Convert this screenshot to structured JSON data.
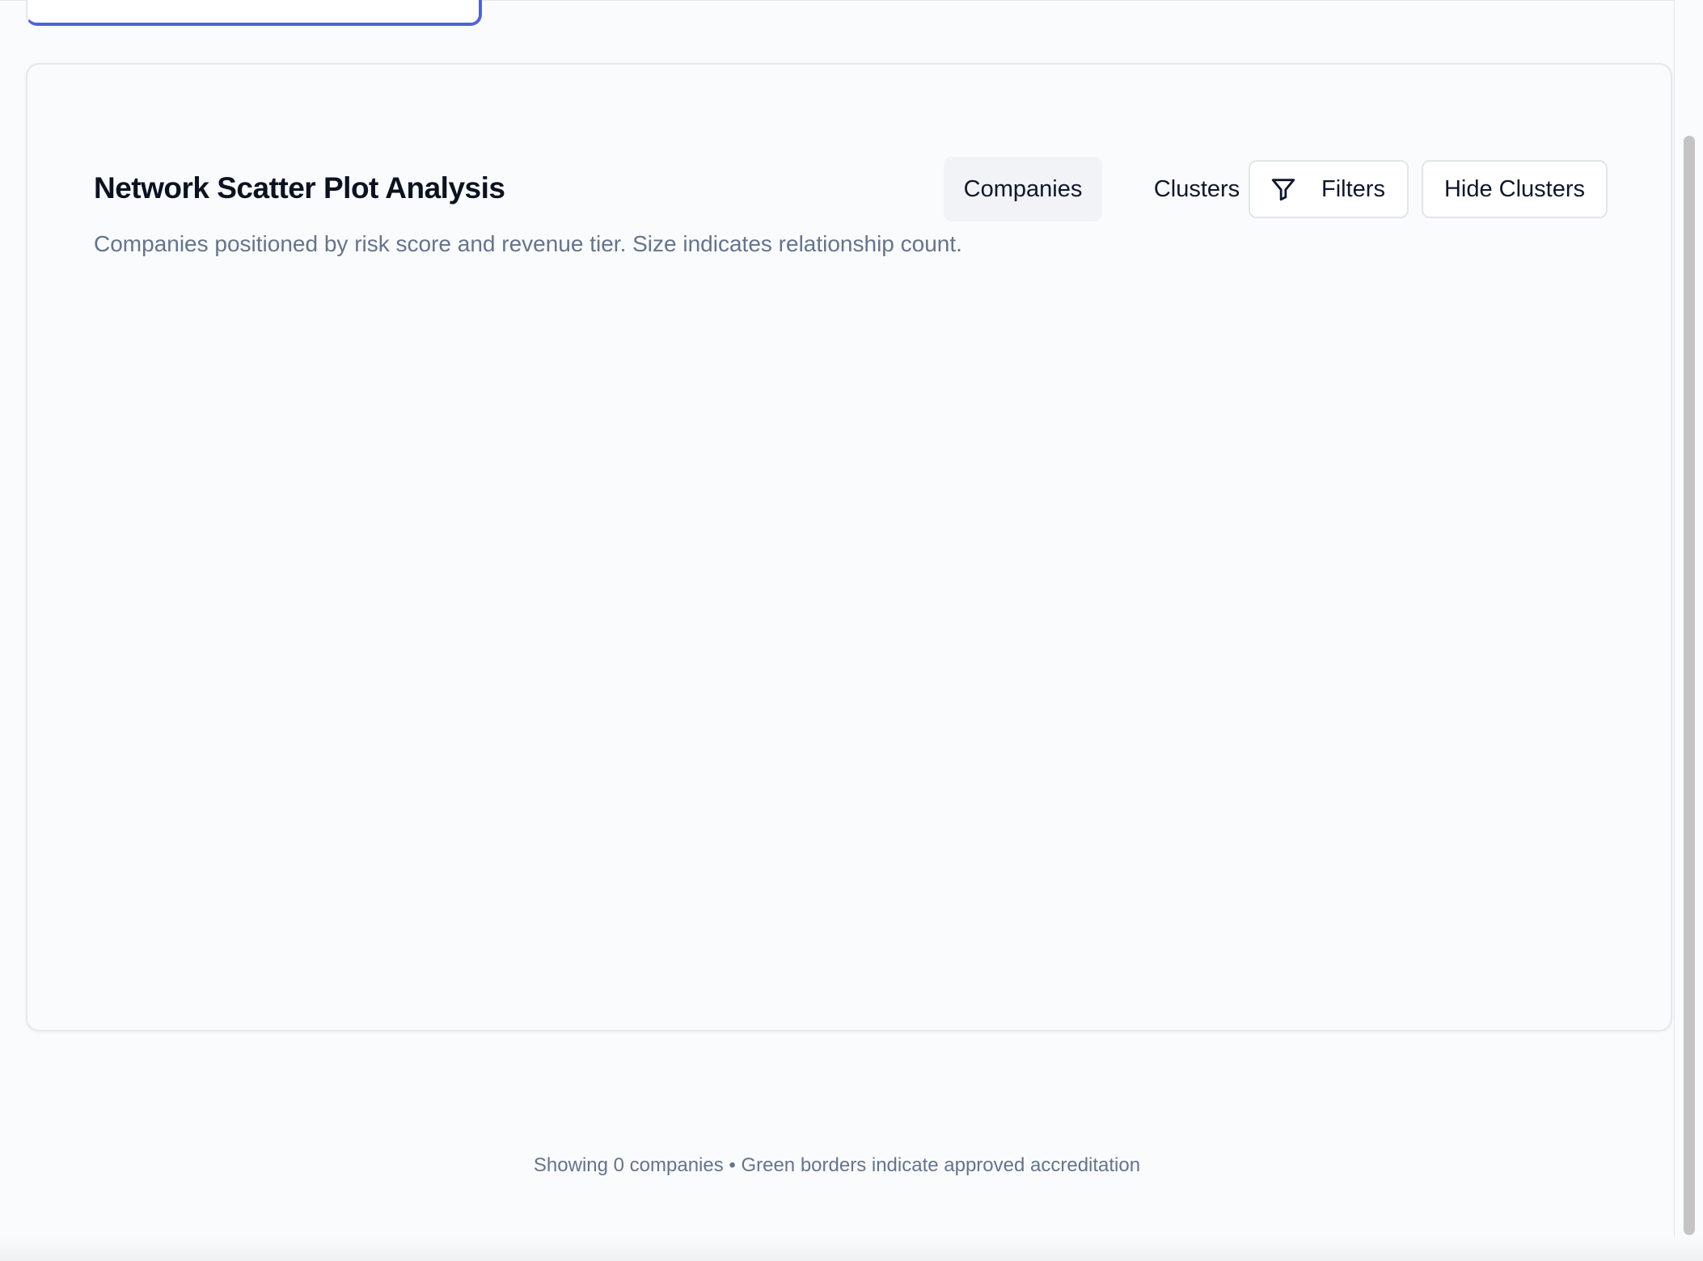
{
  "panel": {
    "title": "Network Scatter Plot Analysis",
    "subtitle": "Companies positioned by risk score and revenue tier. Size indicates relationship count."
  },
  "toolbar": {
    "tabs": [
      {
        "label": "Companies",
        "active": true
      },
      {
        "label": "Clusters",
        "active": false
      }
    ],
    "filters_label": "Filters",
    "filters_icon": "filter-icon",
    "hide_clusters_label": "Hide Clusters"
  },
  "footer": {
    "status": "Showing 0 companies • Green borders indicate approved accreditation"
  },
  "colors": {
    "accent": "#4f63d8",
    "background": "#fafbfc",
    "muted_text": "#64748b"
  }
}
